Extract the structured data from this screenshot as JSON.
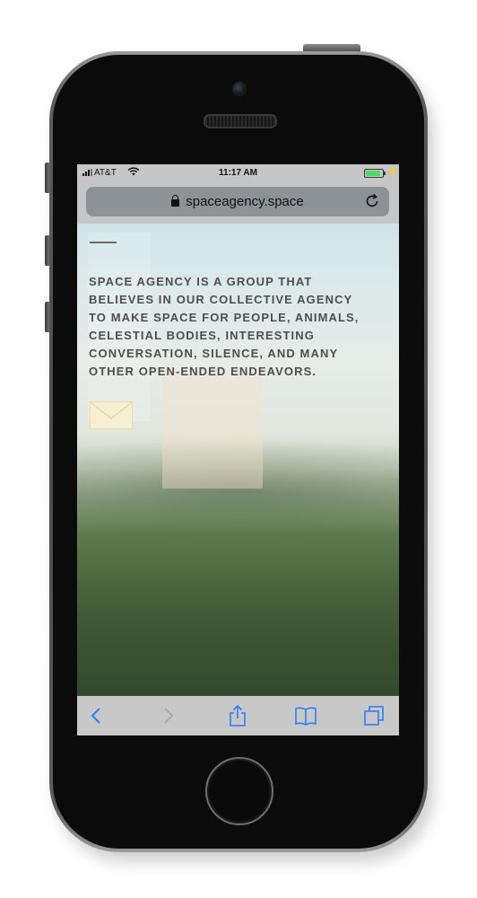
{
  "status_bar": {
    "carrier": "AT&T",
    "time": "11:17 AM",
    "battery_level": 0.9,
    "icons": [
      "signal-icon",
      "wifi-icon",
      "battery-icon",
      "charging-bolt-icon"
    ]
  },
  "browser": {
    "url": "spaceagency.space",
    "icons": [
      "lock-icon",
      "reload-icon"
    ],
    "toolbar": [
      "back-arrow-icon",
      "forward-arrow-icon",
      "share-icon",
      "bookmarks-icon",
      "tabs-icon"
    ]
  },
  "page": {
    "manifesto": "SPACE AGENCY IS A GROUP THAT\nBELIEVES IN OUR COLLECTIVE AGENCY\nTO MAKE SPACE FOR PEOPLE, ANIMALS,\nCELESTIAL BODIES, INTERESTING\nCONVERSATION, SILENCE, AND MANY\nOTHER OPEN-ENDED ENDEAVORS.",
    "icons": [
      "menu-dash-icon",
      "mail-envelope-icon"
    ]
  },
  "colors": {
    "accent_blue": "#2f7cf6",
    "text_gray": "#4e4e4e",
    "battery_green": "#4cd964",
    "envelope": "#f7efd2"
  }
}
